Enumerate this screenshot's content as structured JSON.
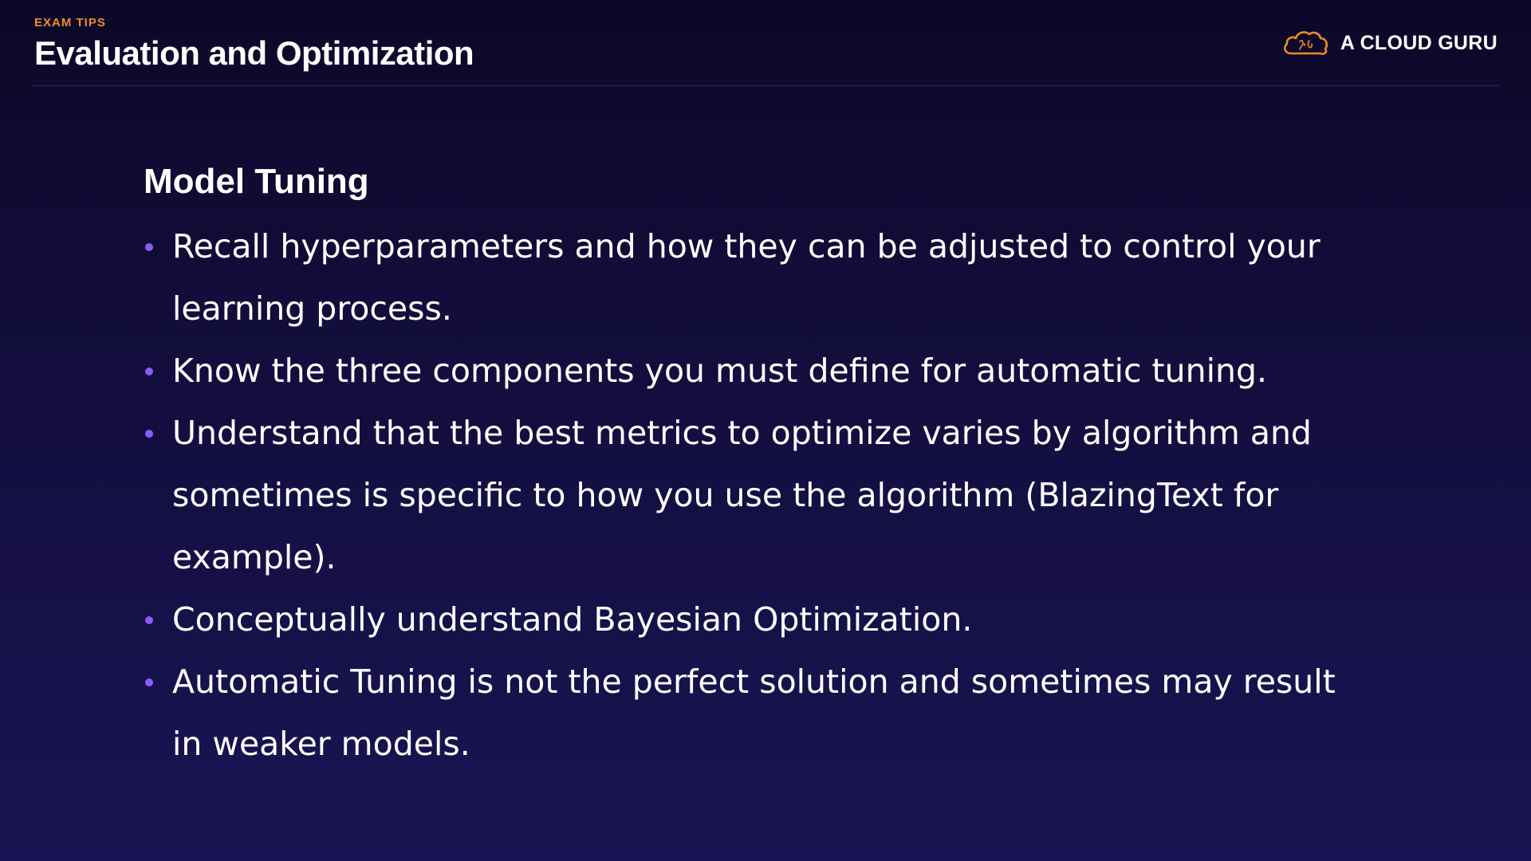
{
  "header": {
    "eyebrow": "EXAM TIPS",
    "title": "Evaluation and Optimization"
  },
  "brand": {
    "name": "A CLOUD GURU",
    "icon": "cloud-guru-logo-icon"
  },
  "content": {
    "heading": "Model Tuning",
    "bullets": [
      "Recall hyperparameters and how they can be adjusted to control your learning process.",
      "Know the three components you must define for automatic tuning.",
      "Understand that the best metrics to optimize varies by algorithm and sometimes is specific to how you use the algorithm (BlazingText for example).",
      "Conceptually understand Bayesian Optimization.",
      "Automatic Tuning is not the perfect solution and sometimes may result in weaker models."
    ]
  },
  "colors": {
    "accent_orange": "#f08a24",
    "bullet_purple": "#8a5cf6",
    "background_top": "#0c0828",
    "background_bottom": "#1a1454"
  }
}
